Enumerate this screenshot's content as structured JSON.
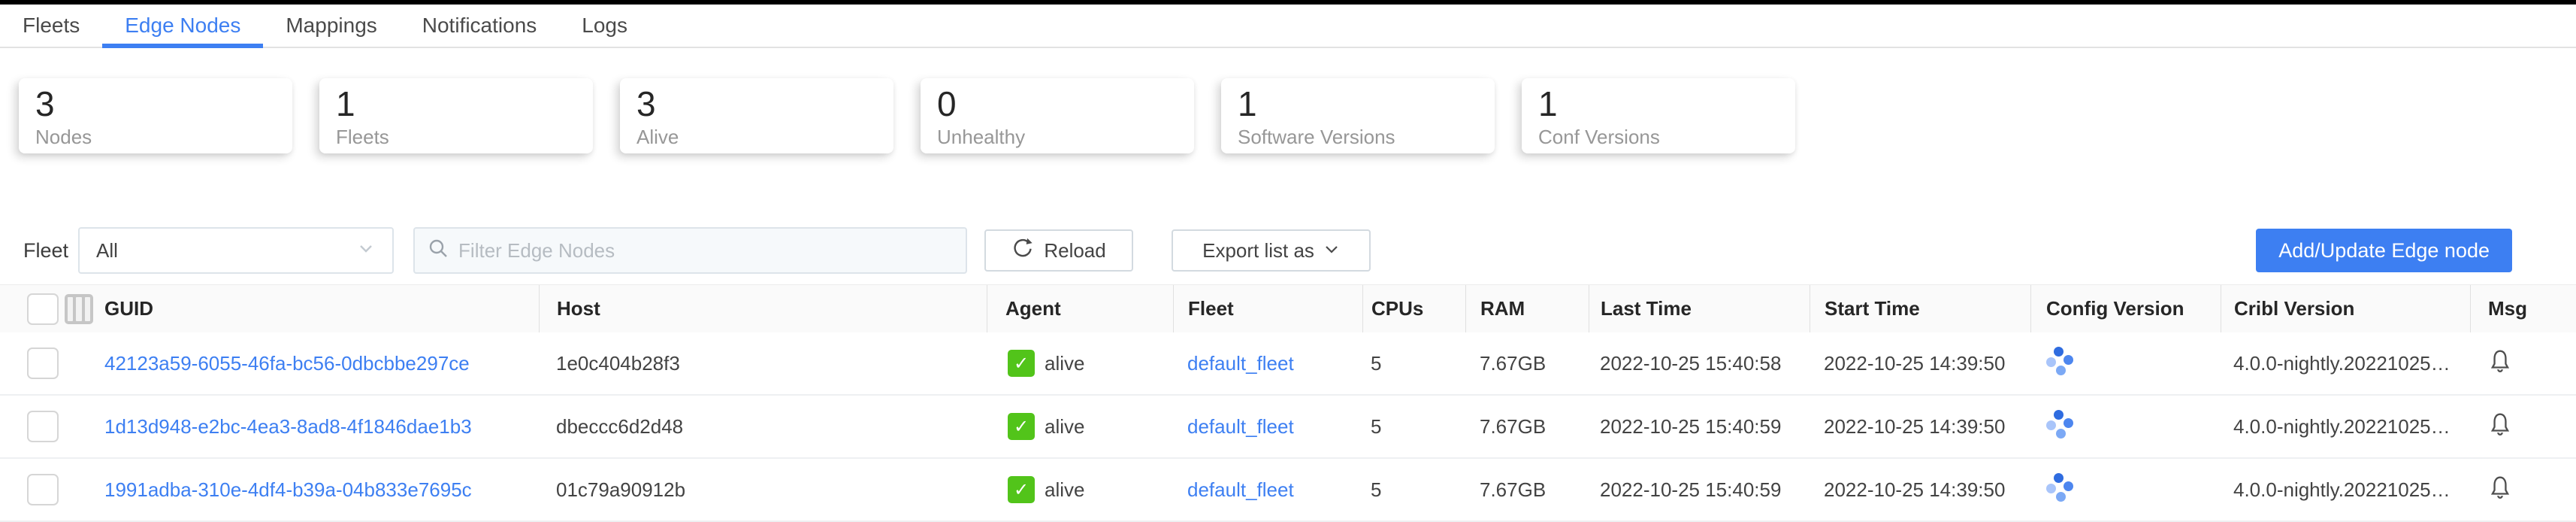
{
  "colors": {
    "accent": "#3d7ff2",
    "alive_green": "#52c41a",
    "link_blue": "#3d7ff2"
  },
  "tabs": {
    "items": [
      {
        "label": "Fleets",
        "active": false
      },
      {
        "label": "Edge Nodes",
        "active": true
      },
      {
        "label": "Mappings",
        "active": false
      },
      {
        "label": "Notifications",
        "active": false
      },
      {
        "label": "Logs",
        "active": false
      }
    ]
  },
  "stats": {
    "cards": [
      {
        "value": "3",
        "label": "Nodes"
      },
      {
        "value": "1",
        "label": "Fleets"
      },
      {
        "value": "3",
        "label": "Alive"
      },
      {
        "value": "0",
        "label": "Unhealthy"
      },
      {
        "value": "1",
        "label": "Software Versions"
      },
      {
        "value": "1",
        "label": "Conf Versions"
      }
    ]
  },
  "toolbar": {
    "fleet_label": "Fleet",
    "fleet_value": "All",
    "search_placeholder": "Filter Edge Nodes",
    "reload_label": "Reload",
    "export_label": "Export list as",
    "add_button": "Add/Update Edge node"
  },
  "table": {
    "columns": [
      "GUID",
      "Host",
      "Agent",
      "Fleet",
      "CPUs",
      "RAM",
      "Last Time",
      "Start Time",
      "Config Version",
      "Cribl Version",
      "Msg"
    ],
    "rows": [
      {
        "guid": "42123a59-6055-46fa-bc56-0dbcbbe297ce",
        "host": "1e0c404b28f3",
        "agent": "alive",
        "fleet": "default_fleet",
        "cpus": "5",
        "ram": "7.67GB",
        "last_time": "2022-10-25 15:40:58",
        "start_time": "2022-10-25 14:39:50",
        "cribl_version": "4.0.0-nightly.20221025…"
      },
      {
        "guid": "1d13d948-e2bc-4ea3-8ad8-4f1846dae1b3",
        "host": "dbeccc6d2d48",
        "agent": "alive",
        "fleet": "default_fleet",
        "cpus": "5",
        "ram": "7.67GB",
        "last_time": "2022-10-25 15:40:59",
        "start_time": "2022-10-25 14:39:50",
        "cribl_version": "4.0.0-nightly.20221025…"
      },
      {
        "guid": "1991adba-310e-4df4-b39a-04b833e7695c",
        "host": "01c79a90912b",
        "agent": "alive",
        "fleet": "default_fleet",
        "cpus": "5",
        "ram": "7.67GB",
        "last_time": "2022-10-25 15:40:59",
        "start_time": "2022-10-25 14:39:50",
        "cribl_version": "4.0.0-nightly.20221025…"
      }
    ]
  }
}
